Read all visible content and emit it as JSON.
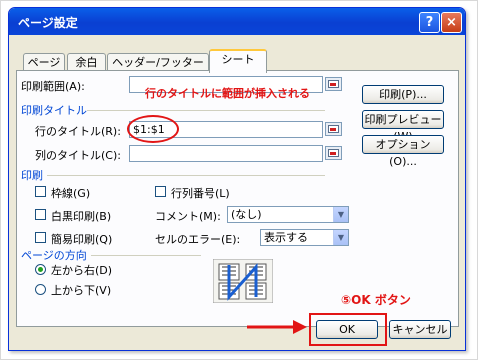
{
  "window": {
    "title": "ページ設定",
    "help_glyph": "?",
    "close_glyph": "×"
  },
  "tabs": [
    "ページ",
    "余白",
    "ヘッダー/フッター",
    "シート"
  ],
  "labels": {
    "print_area": "印刷範囲(A):",
    "print_titles": "印刷タイトル",
    "row_titles": "行のタイトル(R):",
    "col_titles": "列のタイトル(C):",
    "print": "印刷",
    "comments": "コメント(M):",
    "cell_errors": "セルのエラー(E):",
    "page_order": "ページの方向"
  },
  "fields": {
    "print_area": "",
    "row_titles": "$1:$1",
    "col_titles": ""
  },
  "checkboxes": [
    "枠線(G)",
    "白黒印刷(B)",
    "簡易印刷(Q)",
    "行列番号(L)"
  ],
  "selects": {
    "comments": "(なし)",
    "cell_errors": "表示する"
  },
  "radios": [
    {
      "label": "左から右(D)",
      "checked": true
    },
    {
      "label": "上から下(V)",
      "checked": false
    }
  ],
  "buttons": {
    "print": "印刷(P)...",
    "preview": "印刷プレビュー(W)",
    "options": "オプション(O)...",
    "ok": "OK",
    "cancel": "キャンセル"
  },
  "annotations": {
    "row_note": "行のタイトルに範囲が挿入される",
    "ok_note": "⑤OK ボタン"
  },
  "colors": {
    "annotation": "#e21515",
    "section_heading": "#0046d5",
    "title_bar": "#0a45d8"
  }
}
